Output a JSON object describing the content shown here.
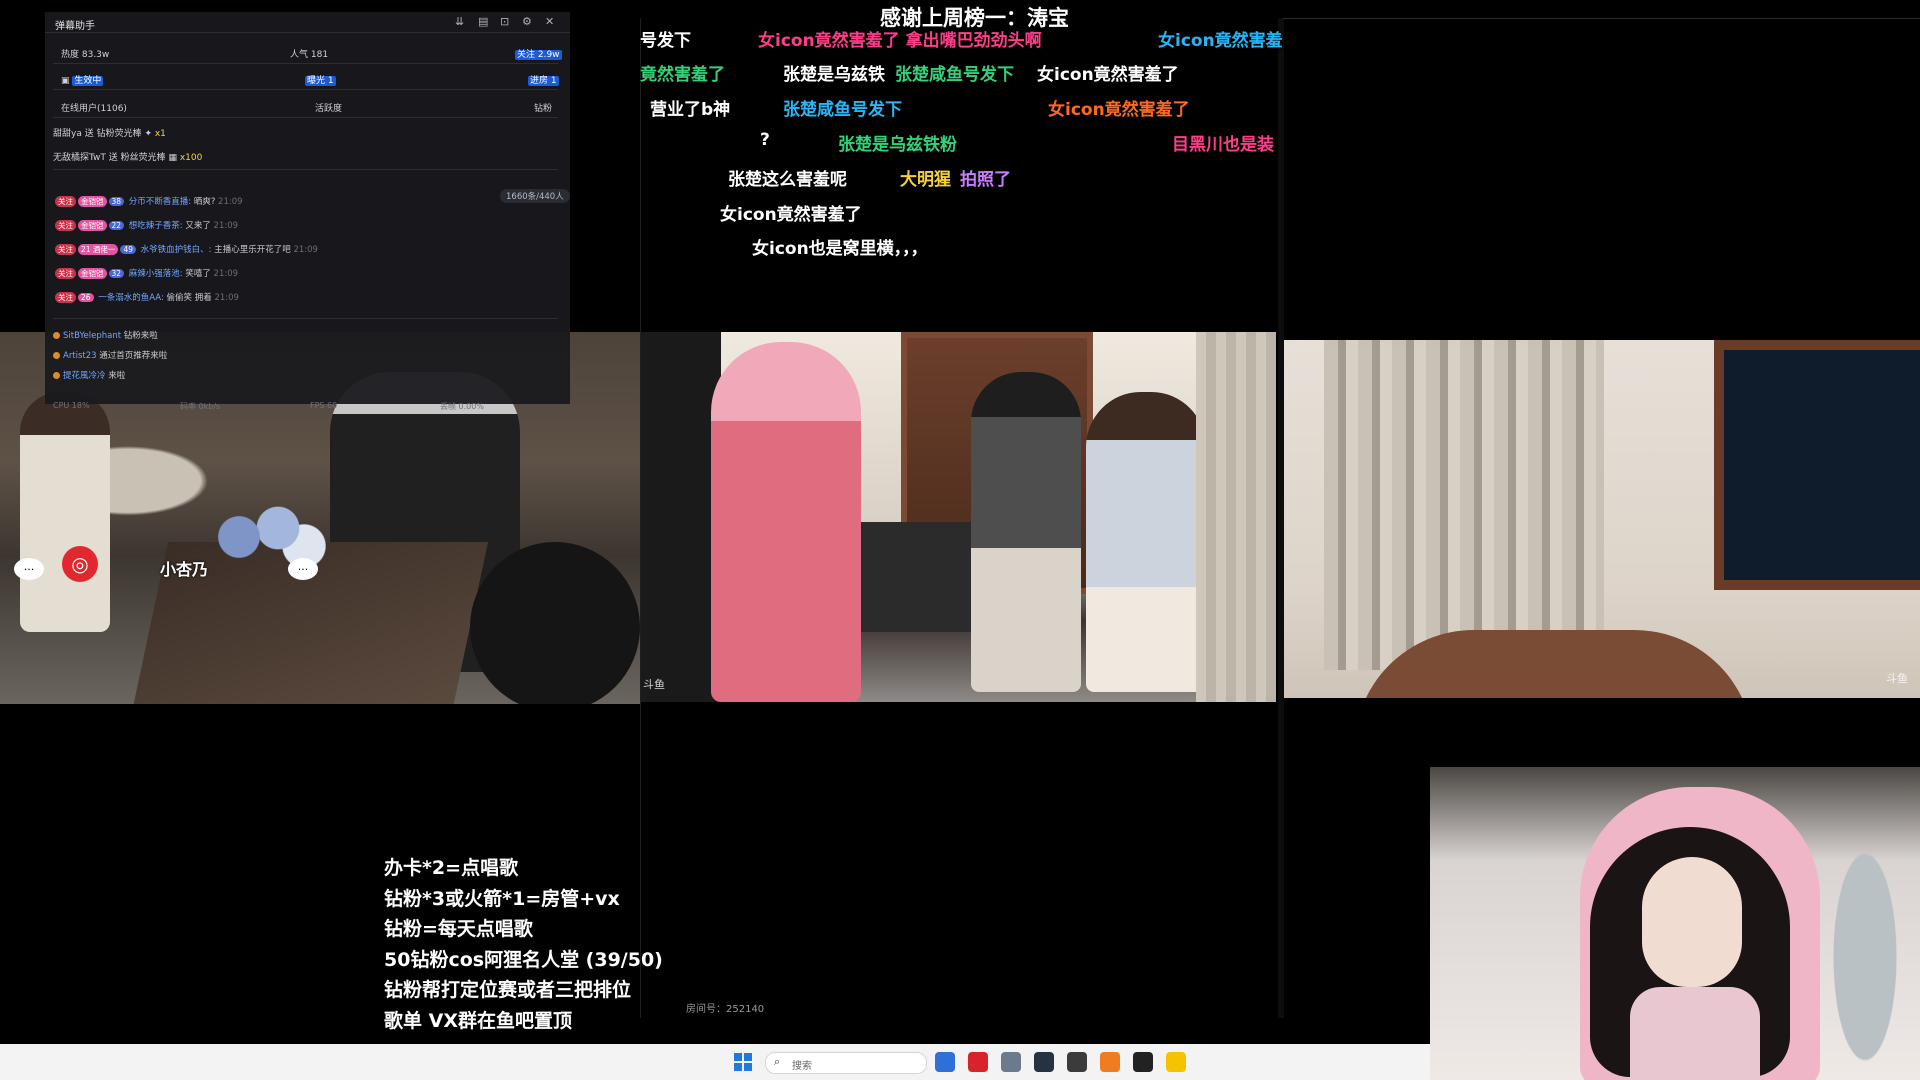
{
  "top_caption": "感谢上周榜一：涛宝",
  "helper": {
    "title": "弹幕助手",
    "stats": {
      "hot": "热度 83.3w",
      "popularity_label": "人气 181",
      "popularity_hl": "1",
      "follow": "关注 2.9w",
      "status": "生效中",
      "exposure": "曝光 1",
      "enter": "进房 1",
      "online": "在线用户(1106)",
      "activity": "活跃度",
      "diamond": "钻粉"
    },
    "gifts": [
      {
        "text": "甜甜ya 送 钻粉荧光棒",
        "amount": "x1"
      },
      {
        "text": "无敌橘探TwT 送 粉丝荧光棒",
        "amount": "x100"
      }
    ],
    "count_badge": "1660条/440人",
    "chat": [
      {
        "tags": [
          "关注",
          "金铠铠",
          "38"
        ],
        "user": "分币不断香直播:",
        "msg": "晒爽?",
        "time": "21:09"
      },
      {
        "tags": [
          "关注",
          "金铠铠",
          "22"
        ],
        "user": "想吃辣子香茶:",
        "msg": "又来了",
        "time": "21:09"
      },
      {
        "tags": [
          "关注",
          "21 酒佬一",
          "49"
        ],
        "user": "水爷铁血护钱白、:",
        "msg": "主播心里乐开花了吧",
        "time": "21:09"
      },
      {
        "tags": [
          "关注",
          "金铠铠",
          "32"
        ],
        "user": "麻辣小强落池:",
        "msg": "笑嘻了",
        "time": "21:09"
      },
      {
        "tags": [
          "关注",
          "26"
        ],
        "user": "一条溺水的鱼AA:",
        "msg": "偷偷笑 拥着",
        "time": "21:09"
      }
    ],
    "system": [
      {
        "user": "SitBYelephant",
        "action": "钻粉来啦"
      },
      {
        "user": "Artist23",
        "action": "通过首页推荐来啦"
      },
      {
        "user": "提花風冷冷",
        "action": "来啦"
      }
    ],
    "perf": {
      "cpu": "CPU 18%",
      "net": "码率 0kb/s",
      "fps": "FPS 60",
      "loss": "丢帧 0.00%"
    }
  },
  "danmaku": [
    {
      "text": "号发下",
      "color": "#ffffff"
    },
    {
      "text": "女icon竟然害羞了 拿出嘴巴劲劲头啊",
      "color": "#ff3d8b"
    },
    {
      "text": "女icon竟然害羞",
      "color": "#29b6f6"
    },
    {
      "text": "竟然害羞了",
      "color": "#33d17a"
    },
    {
      "text": "张楚是乌兹铁",
      "color": "#ffffff"
    },
    {
      "text": "张楚咸鱼号发下",
      "color": "#33d17a"
    },
    {
      "text": "女icon竟然害羞了",
      "color": "#ffffff"
    },
    {
      "text": "营业了b神",
      "color": "#ffffff"
    },
    {
      "text": "张楚咸鱼号发下",
      "color": "#29b6f6"
    },
    {
      "text": "女icon竟然害羞了",
      "color": "#ff6a1f"
    },
    {
      "text": "?",
      "color": "#ffffff"
    },
    {
      "text": "张楚是乌兹铁粉",
      "color": "#33d17a"
    },
    {
      "text": "目黑川也是装",
      "color": "#ff3d8b"
    },
    {
      "text": "张楚这么害羞呢",
      "color": "#ffffff"
    },
    {
      "text": "大明猩",
      "color": "#f7d23a"
    },
    {
      "text": "拍照了",
      "color": "#c77dff"
    },
    {
      "text": "女icon竟然害羞了",
      "color": "#ffffff"
    },
    {
      "text": "女icon也是窝里横，，，",
      "color": "#ffffff"
    }
  ],
  "streamer_tag": "小杏乃",
  "bubble_a": "···",
  "bubble_b": "···",
  "logo_glyph": "◎",
  "rules": [
    "办卡*2=点唱歌",
    "钻粉*3或火箭*1=房管+vx",
    "钻粉=每天点唱歌",
    "50钻粉cos阿狸名人堂 (39/50)",
    "钻粉帮打定位赛或者三把排位",
    "歌单 VX群在鱼吧置顶"
  ],
  "room_id": "房间号：252140",
  "taskbar": {
    "search_placeholder": "搜索",
    "search_icon": "search-icon",
    "apps": [
      "browser-icon",
      "netease-music-icon",
      "file-explorer-icon",
      "terminal-icon",
      "obs-icon",
      "douyu-icon",
      "game-icon",
      "minion-icon"
    ]
  },
  "watermarks": {
    "douyu": "斗鱼"
  },
  "colors": {
    "accent": "#1c5bd6",
    "danmaku_green": "#33d17a",
    "danmaku_pink": "#ff3d8b",
    "danmaku_blue": "#29b6f6"
  }
}
